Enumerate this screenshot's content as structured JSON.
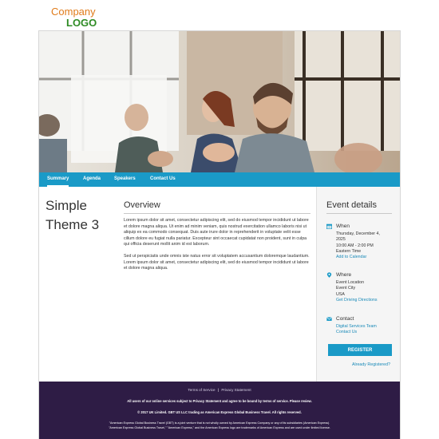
{
  "brand": {
    "logo_line1": "Company",
    "logo_line2": "LOGO"
  },
  "nav": {
    "items": [
      {
        "label": "Summary",
        "active": true
      },
      {
        "label": "Agenda"
      },
      {
        "label": "Speakers"
      },
      {
        "label": "Contact Us"
      }
    ]
  },
  "page": {
    "title_line1": "Simple",
    "title_line2": "Theme 3"
  },
  "overview": {
    "heading": "Overview",
    "paragraph1": "Lorem ipsum dolor sit amet, consectetur adipiscing elit, sed do eiusmod tempor incididunt ut labore et dolore magna aliqua. Ut enim ad minim veniam, quis nostrud exercitation ullamco laboris nisi ut aliquip ex ea commodo consequat. Duis aute irure dolor in reprehenderit in voluptate velit esse cillum dolore eu fugiat nulla pariatur. Excepteur sint occaecat cupidatat non proident, sunt in culpa qui officia deserunt mollit anim id est laborum.",
    "paragraph2": "Sed ut perspiciatis unde omnis iste natus error sit voluptatem accusantium doloremque laudantium. Lorem ipsum dolor sit amet, consectetur adipiscing elit, sed do eiusmod tempor incididunt ut labore et dolore magna aliqua."
  },
  "event": {
    "heading": "Event details",
    "when": {
      "label": "When",
      "date_line1": "Thursday, December 4,",
      "date_line2": "2025",
      "time": "10:00 AM - 2:00 PM",
      "timezone": "Eastern Time",
      "add_to_calendar": "Add to Calendar"
    },
    "where": {
      "label": "Where",
      "location": "Event Location",
      "city": "Event City",
      "country": "USA",
      "directions": "Get Driving Directions"
    },
    "contact": {
      "label": "Contact",
      "team": "Digital Services Team",
      "contact_us": "Contact Us"
    },
    "register_label": "REGISTER",
    "already_registered": "Already Registered?"
  },
  "footer": {
    "terms": "Terms of Service",
    "separator": "|",
    "privacy": "Privacy Statement",
    "line1": "All users of our online services subject to Privacy Statement and agree to be bound by terms of service. Please review.",
    "line2": "© 2017 UK Limited. GBT US LLC trading as American Express Global Business Travel. All rights reserved.",
    "line3": "\"American Express Global Business Travel (GBT) is a joint venture that is not wholly owned by American Express Company or any of its subsidiaries (American Express).",
    "line4": "\"American Express Global Business Travel,\" \"American Express,\" and the American Express logo are trademarks of American Express and are used under limited license."
  },
  "colors": {
    "accent": "#1a9ac7",
    "footer_bg": "#2e1c45",
    "logo_company": "#e07b1a",
    "logo_text": "#2e8b24",
    "link": "#1a8ab8"
  },
  "icons": {
    "when": "calendar-icon",
    "where": "map-pin-icon",
    "contact": "envelope-icon"
  }
}
